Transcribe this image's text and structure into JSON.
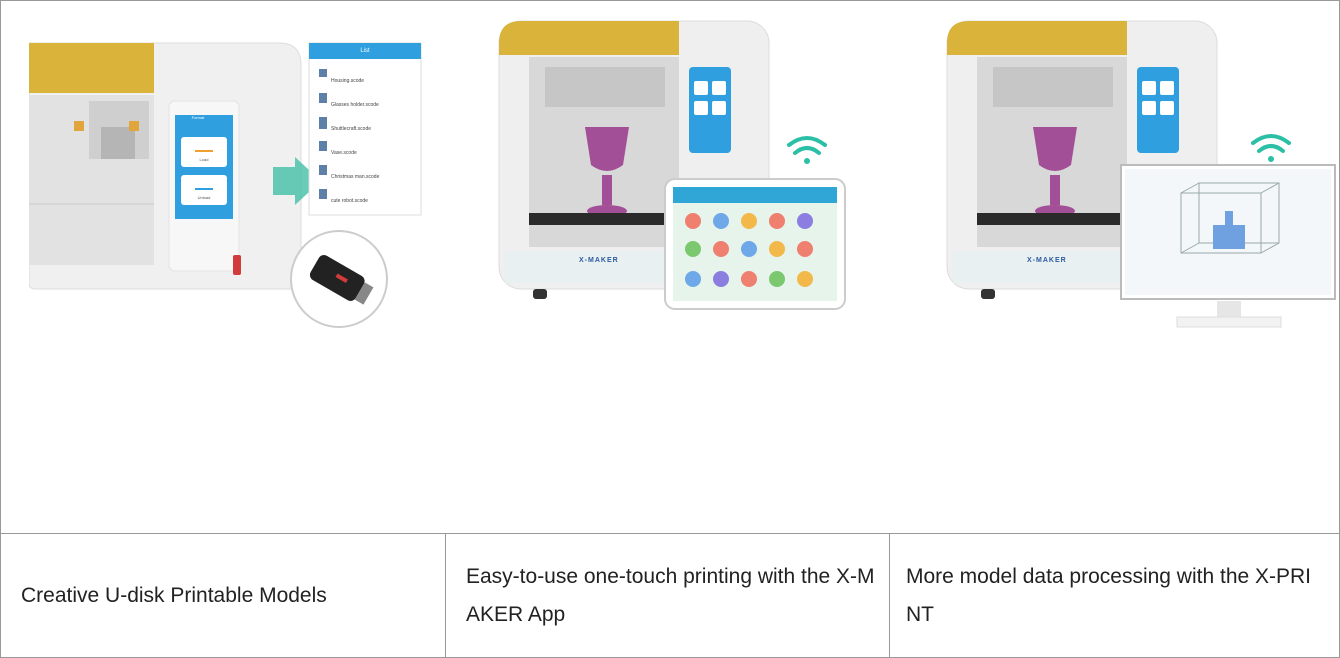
{
  "usb_panel": {
    "list_title": "List",
    "screen_title": "Format",
    "load_label": "Load",
    "unload_label": "Unload",
    "files": [
      "Housing.scode",
      "Glasses holder.scode",
      "Shuttlecraft.scode",
      "Vase.scode",
      "Christmas man.scode",
      "cute robot.scode"
    ]
  },
  "printer_brand": "X-MAKER",
  "captions": {
    "usb": "Creative U-disk Printable Models",
    "app": "Easy-to-use one-touch printing with the X-MAKER App",
    "print": "More model data processing with the X-PRINT"
  },
  "colors": {
    "printer_top": "#d9b33a",
    "printer_body": "#ececec",
    "printer_base_accent": "#2ab0c8",
    "model_purple": "#a24f97",
    "wifi": "#2bbfa6",
    "usb_arrow": "#43bfa6"
  }
}
